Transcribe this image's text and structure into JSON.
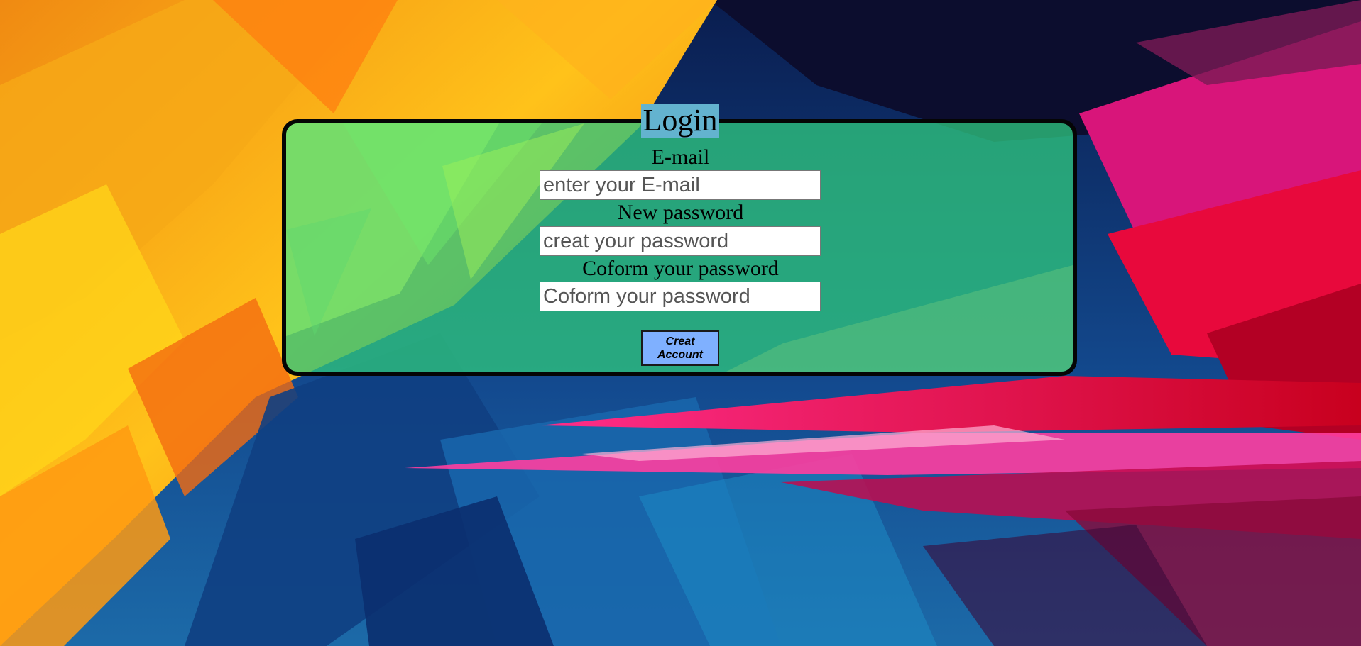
{
  "page": {
    "title": "Login"
  },
  "form": {
    "email_label": "E-mail",
    "email_placeholder": "enter your E-mail",
    "email_value": "",
    "password_label": "New password",
    "password_placeholder": "creat your password",
    "password_value": "",
    "confirm_label": "Coform your password",
    "confirm_placeholder": "Coform your password",
    "confirm_value": "",
    "submit_label": "Creat Account"
  },
  "colors": {
    "card_background": "#2ec47e",
    "title_background": "#63b3cf",
    "button_background": "#7fb0ff",
    "card_border": "#050505"
  }
}
